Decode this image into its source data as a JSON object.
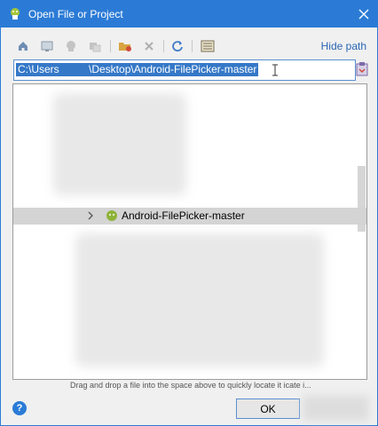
{
  "window": {
    "title": "Open File or Project"
  },
  "toolbar": {
    "buttons": [
      {
        "name": "home-icon"
      },
      {
        "name": "desktop-icon"
      },
      {
        "name": "project-icon"
      },
      {
        "name": "module-icon"
      },
      {
        "name": "new-folder-icon"
      },
      {
        "name": "delete-icon"
      },
      {
        "name": "refresh-icon"
      },
      {
        "name": "show-hidden-icon"
      }
    ],
    "hide_path_label": "Hide path"
  },
  "path": {
    "value": "C:\\Users          \\Desktop\\Android-FilePicker-master"
  },
  "tree": {
    "selected_item": {
      "label": "Android-FilePicker-master",
      "icon": "android-folder-icon"
    }
  },
  "hint": "Drag and drop a file into the space above to quickly locate it icate i...",
  "buttons": {
    "ok": "OK",
    "help": "?"
  },
  "colors": {
    "titlebar": "#2b7bd6",
    "selection": "#3578c7",
    "link": "#2a65b3"
  }
}
